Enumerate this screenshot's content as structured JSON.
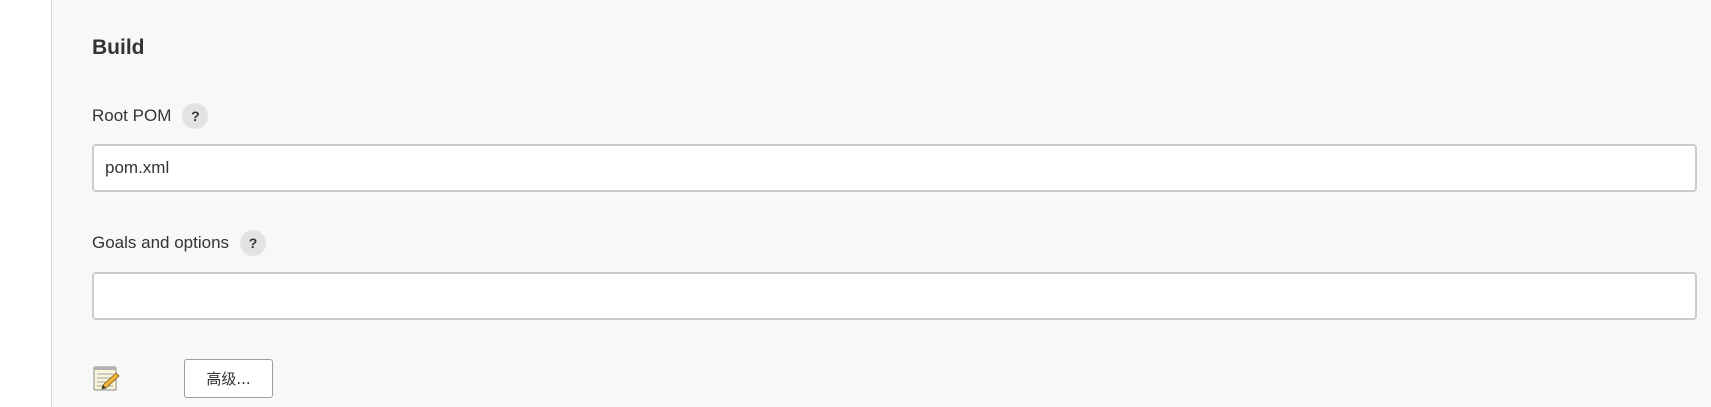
{
  "section": {
    "title": "Build"
  },
  "fields": {
    "root_pom": {
      "label": "Root POM",
      "help": "?",
      "value": "pom.xml"
    },
    "goals": {
      "label": "Goals and options",
      "help": "?",
      "value": ""
    }
  },
  "actions": {
    "advanced_label": "高级..."
  },
  "icons": {
    "notepad": "notepad-icon"
  },
  "colors": {
    "section_bg": "#f8f8f8",
    "input_border": "#c9ccd0",
    "help_bg": "#e3e3e3"
  }
}
